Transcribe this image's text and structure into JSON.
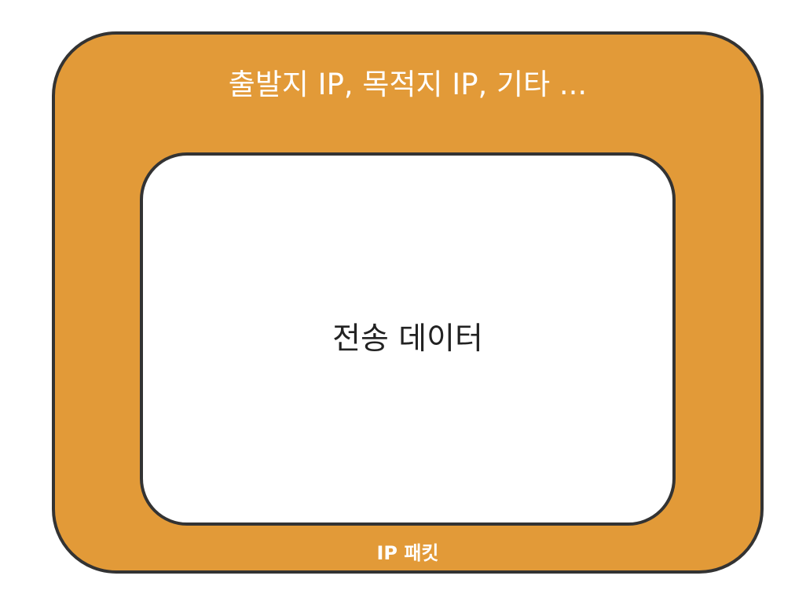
{
  "diagram": {
    "header_label": "출발지 IP, 목적지 IP, 기타 ...",
    "payload_label": "전송 데이터",
    "packet_label": "IP 패킷",
    "colors": {
      "packet": "#e29a38",
      "payload": "#ffffff",
      "border": "#333333"
    }
  }
}
